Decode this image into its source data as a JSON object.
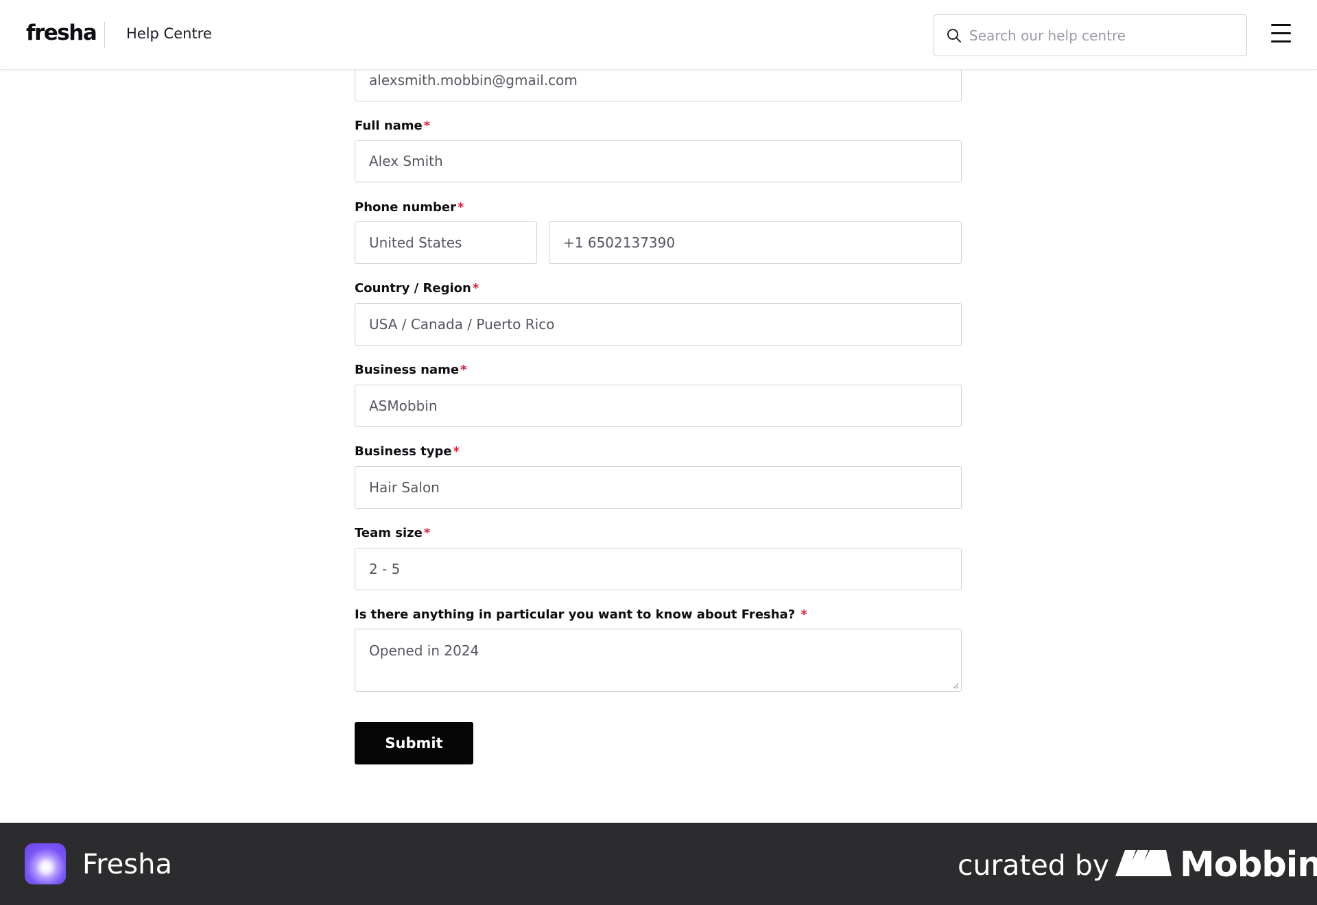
{
  "header": {
    "logo": "fresha",
    "section": "Help Centre",
    "search_placeholder": "Search our help centre",
    "search_icon": "search-icon",
    "menu_icon": "hamburger-menu-icon"
  },
  "form": {
    "email": {
      "value": "alexsmith.mobbin@gmail.com"
    },
    "full_name": {
      "label": "Full name",
      "required": "*",
      "value": "Alex Smith"
    },
    "phone": {
      "label": "Phone number",
      "required": "*",
      "country": "United States",
      "value": "+1 6502137390"
    },
    "country_region": {
      "label": "Country / Region",
      "required": "*",
      "value": "USA / Canada / Puerto Rico"
    },
    "business_name": {
      "label": "Business name",
      "required": "*",
      "value": "ASMobbin"
    },
    "business_type": {
      "label": "Business type",
      "required": "*",
      "value": "Hair Salon"
    },
    "team_size": {
      "label": "Team size",
      "required": "*",
      "value": "2 - 5"
    },
    "question": {
      "label": "Is there anything in particular you want to know about Fresha?",
      "required": "*",
      "value": "Opened in 2024"
    },
    "submit_label": "Submit"
  },
  "footer": {
    "app_name": "Fresha",
    "curated_by": "curated by",
    "brand": "Mobbin"
  },
  "colors": {
    "required_asterisk": "#d81e3a",
    "submit_button": "#050505",
    "footer_background": "#2c2c2e",
    "app_icon": "#6a40ee"
  }
}
